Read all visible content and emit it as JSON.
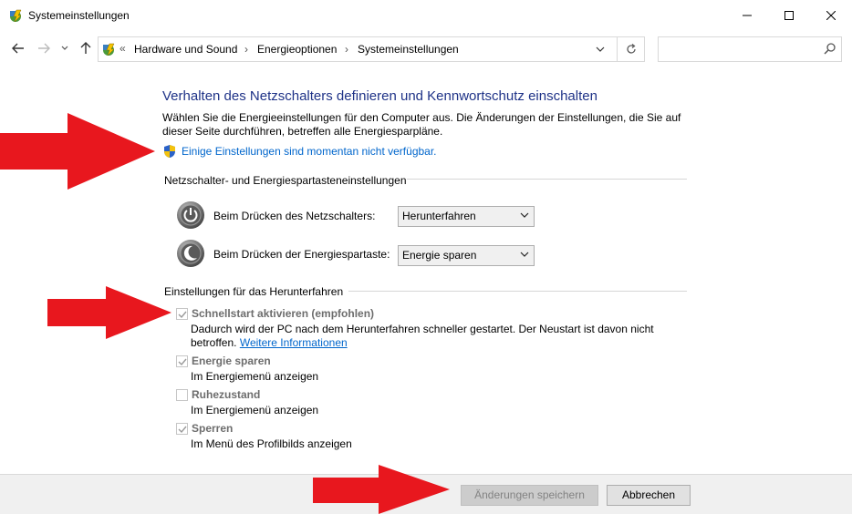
{
  "window": {
    "title": "Systemeinstellungen",
    "minimize_icon": "minimize-icon",
    "maximize_icon": "maximize-icon",
    "close_icon": "close-icon"
  },
  "address": {
    "overflow": "«",
    "crumbs": [
      "Hardware und Sound",
      "Energieoptionen",
      "Systemeinstellungen"
    ],
    "separator": "›",
    "search_placeholder": ""
  },
  "content": {
    "heading": "Verhalten des Netzschalters definieren und Kennwortschutz einschalten",
    "description": "Wählen Sie die Energieeinstellungen für den Computer aus. Die Änderungen der Einstellungen, die Sie auf dieser Seite durchführen, betreffen alle Energiesparpläne.",
    "admin_link": "Einige Einstellungen sind momentan nicht verfügbar.",
    "power_group_label": "Netzschalter- und Energiespartasteneinstellungen",
    "power_button_label": "Beim Drücken des Netzschalters:",
    "power_button_value": "Herunterfahren",
    "sleep_button_label": "Beim Drücken der Energiespartaste:",
    "sleep_button_value": "Energie sparen",
    "shutdown_group_label": "Einstellungen für das Herunterfahren",
    "fast_startup": {
      "title": "Schnellstart aktivieren (empfohlen)",
      "checked": true,
      "desc_part1": "Dadurch wird der PC nach dem Herunterfahren schneller gestartet. Der Neustart ist davon nicht betroffen.",
      "link": "Weitere Informationen"
    },
    "sleep": {
      "title": "Energie sparen",
      "checked": true,
      "desc": "Im Energiemenü anzeigen"
    },
    "hibernate": {
      "title": "Ruhezustand",
      "checked": false,
      "desc": "Im Energiemenü anzeigen"
    },
    "lock": {
      "title": "Sperren",
      "checked": true,
      "desc": "Im Menü des Profilbilds anzeigen"
    }
  },
  "footer": {
    "save_label": "Änderungen speichern",
    "cancel_label": "Abbrechen"
  },
  "colors": {
    "heading": "#1e3287",
    "link": "#0066cc",
    "arrow": "#e8171e",
    "disabled_text": "#6d6d6d"
  }
}
